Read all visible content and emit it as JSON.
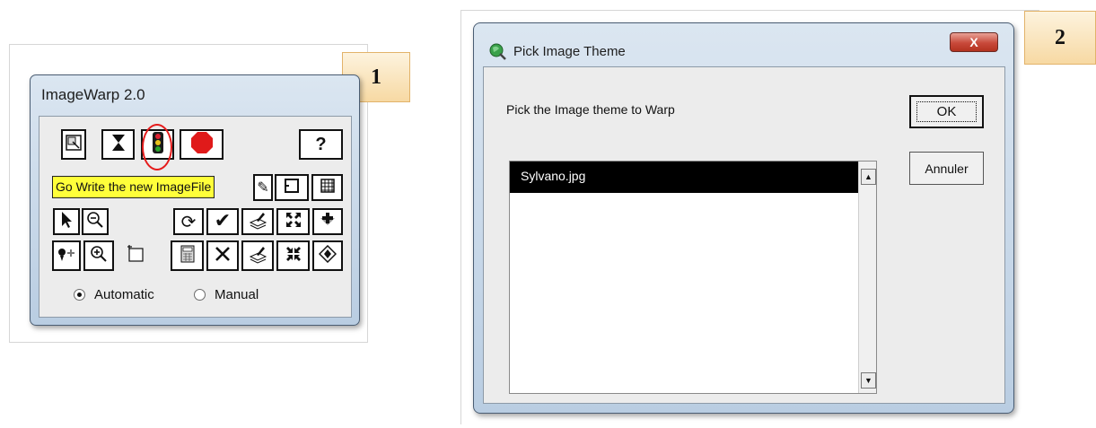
{
  "panel1": {
    "callout_number": "1",
    "window_title": "ImageWarp 2.0",
    "tooltip": "Go Write the new ImageFile",
    "help_label": "?",
    "radio_options": [
      {
        "label": "Automatic",
        "selected": true
      },
      {
        "label": "Manual",
        "selected": false
      }
    ],
    "highlight_color": "#e51b1b",
    "tooltip_color": "#ffff3a"
  },
  "panel2": {
    "callout_number": "2",
    "window_title": "Pick Image Theme",
    "close_label": "X",
    "prompt": "Pick the Image theme to Warp",
    "ok_label": "OK",
    "cancel_label": "Annuler",
    "list_items": [
      "Sylvano.jpg"
    ],
    "selected_item": "Sylvano.jpg"
  },
  "icons": {
    "row1": [
      "select-extent-icon",
      "hourglass-icon",
      "traffic-light-icon",
      "stop-icon"
    ],
    "row2_right": [
      "frame-icon",
      "grid-icon"
    ],
    "row3": [
      "pointer-arrow-icon",
      "zoom-out-icon",
      "refresh-icon",
      "check-icon",
      "stack-edit-icon",
      "expand-icon",
      "move-down-icon"
    ],
    "row4": [
      "add-point-icon",
      "zoom-in-icon",
      "new-frame-icon",
      "calculator-icon",
      "delete-icon",
      "stack-edit-icon",
      "shrink-icon",
      "pan-icon"
    ]
  }
}
